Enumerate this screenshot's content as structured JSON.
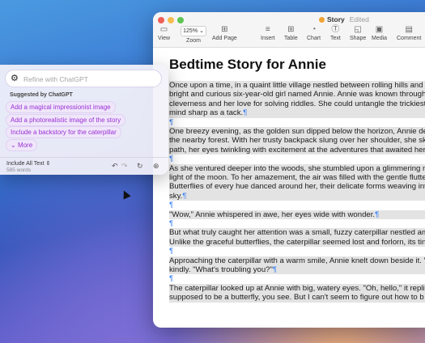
{
  "window": {
    "title": "Story",
    "status": "Edited"
  },
  "toolbar": {
    "view": "View",
    "zoom_value": "125%",
    "zoom": "Zoom",
    "add_page": "Add Page",
    "insert": "Insert",
    "table": "Table",
    "chart": "Chart",
    "text": "Text",
    "shape": "Shape",
    "media": "Media",
    "comment": "Comment"
  },
  "document": {
    "heading": "Bedtime Story for Annie",
    "paragraphs": [
      [
        "Once upon a time, in a quaint little village nestled between rolling hills and l",
        "bright and curious six-year-old girl named Annie. Annie was known through",
        "cleverness and her love for solving riddles. She could untangle the trickiest",
        "mind sharp as a tack."
      ],
      [
        "One breezy evening, as the golden sun dipped below the horizon, Annie de",
        "the nearby forest. With her trusty backpack slung over her shoulder, she sk",
        "path, her eyes twinkling with excitement at the adventures that awaited her."
      ],
      [
        "As she ventured deeper into the woods, she stumbled upon a glimmering m",
        "light of the moon. To her amazement, the air was filled with the gentle flutte",
        "Butterflies of every hue danced around her, their delicate forms weaving int",
        "sky."
      ],
      [
        "\"Wow,\" Annie whispered in awe, her eyes wide with wonder."
      ],
      [
        "But what truly caught her attention was a small, fuzzy caterpillar nestled am",
        "Unlike the graceful butterflies, the caterpillar seemed lost and forlorn, its tin"
      ],
      [
        "Approaching the caterpillar with a warm smile, Annie knelt down beside it. \"",
        "kindly. \"What's troubling you?\""
      ],
      [
        "The caterpillar looked up at Annie with big, watery eyes. \"Oh, hello,\" it repli",
        "supposed to be a butterfly, you see. But I can't seem to figure out how to b"
      ]
    ]
  },
  "writing_tools": {
    "placeholder": "Refine with ChatGPT",
    "suggested_title": "Suggested by ChatGPT",
    "suggestions": [
      "Add a magical impressionist image",
      "Add a photorealistic image of the story",
      "Include a backstory for the caterpillar"
    ],
    "more": "More",
    "scope": "Include All Text",
    "word_count": "585 words"
  },
  "colors": {
    "accent": "#9b2fd6",
    "pilcrow": "#3b82f6"
  }
}
